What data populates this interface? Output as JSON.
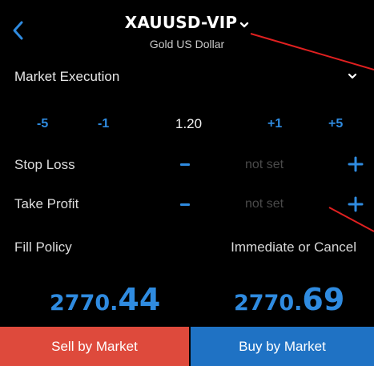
{
  "header": {
    "symbol": "XAUUSD-VIP",
    "description": "Gold US Dollar",
    "back_icon": "chevron-left-icon",
    "symbol_dropdown_icon": "chevron-down-icon"
  },
  "order": {
    "execution_type": "Market Execution",
    "volume": {
      "minus5_label": "-5",
      "minus1_label": "-1",
      "value": "1.20",
      "plus1_label": "+1",
      "plus5_label": "+5"
    },
    "stop_loss": {
      "label": "Stop Loss",
      "value": "not set"
    },
    "take_profit": {
      "label": "Take Profit",
      "value": "not set"
    },
    "fill_policy": {
      "label": "Fill Policy",
      "value": "Immediate or Cancel"
    }
  },
  "prices": {
    "bid_prefix": "2770.",
    "bid_suffix": "44",
    "ask_prefix": "2770.",
    "ask_suffix": "69"
  },
  "actions": {
    "sell_label": "Sell by Market",
    "buy_label": "Buy by Market"
  },
  "colors": {
    "accent": "#2f8be0",
    "sell": "#de4a3c",
    "buy": "#1f72c4",
    "annotation_line": "#e02020",
    "background": "#000000"
  }
}
